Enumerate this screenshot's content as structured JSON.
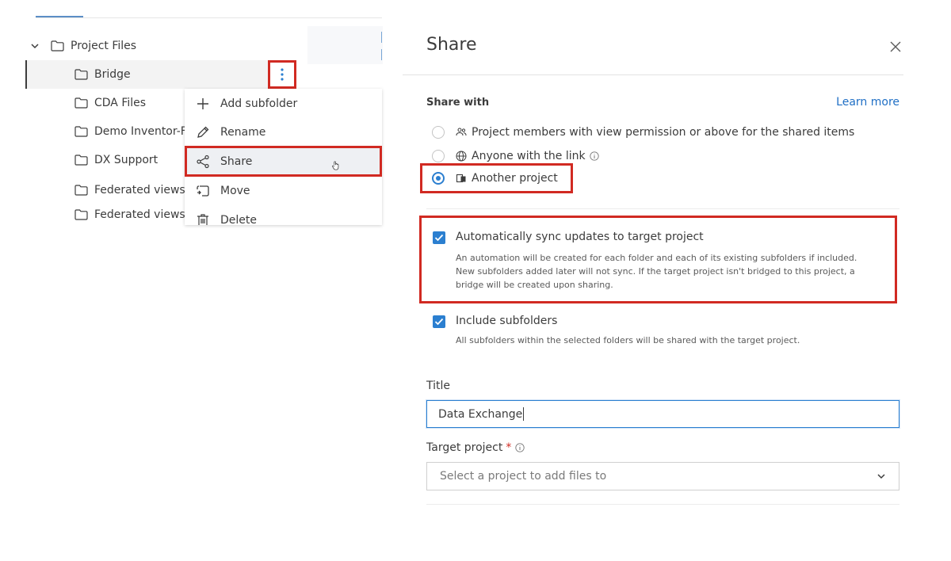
{
  "tree": {
    "items": [
      {
        "label": "Project Files"
      },
      {
        "label": "Bridge"
      },
      {
        "label": "CDA Files"
      },
      {
        "label": "Demo Inventor-F"
      },
      {
        "label": "DX Support"
      },
      {
        "label": "Federated views"
      },
      {
        "label": "Federated views"
      }
    ]
  },
  "context_menu": {
    "items": [
      {
        "label": "Add subfolder",
        "icon": "plus-icon"
      },
      {
        "label": "Rename",
        "icon": "pencil-icon"
      },
      {
        "label": "Share",
        "icon": "share-icon"
      },
      {
        "label": "Move",
        "icon": "move-icon"
      },
      {
        "label": "Delete",
        "icon": "trash-icon"
      }
    ]
  },
  "share_panel": {
    "title": "Share",
    "share_with_label": "Share with",
    "learn_more": "Learn more",
    "options": [
      {
        "label": "Project members with view permission or above for the shared items",
        "selected": false,
        "icon": "people-icon"
      },
      {
        "label": "Anyone with the link",
        "selected": false,
        "icon": "globe-icon"
      },
      {
        "label": "Another project",
        "selected": true,
        "icon": "project-icon"
      }
    ],
    "auto_sync": {
      "checked": true,
      "label": "Automatically sync updates to target project",
      "desc_line1": "An automation will be created for each folder and each of its existing subfolders if included.",
      "desc_line2": "New subfolders added later will not sync. If the target project isn't bridged to this project, a",
      "desc_line3": "bridge will be created upon sharing."
    },
    "include_subfolders": {
      "checked": true,
      "label": "Include subfolders",
      "desc": "All subfolders within the selected folders will be shared with the target project."
    },
    "title_field": {
      "label": "Title",
      "value": "Data Exchange"
    },
    "target_project": {
      "label": "Target project",
      "required_mark": "*",
      "placeholder": "Select a project to add files to"
    }
  },
  "colors": {
    "accent": "#2b7fd0",
    "highlight": "#d12a22",
    "link": "#1f6fc5"
  }
}
